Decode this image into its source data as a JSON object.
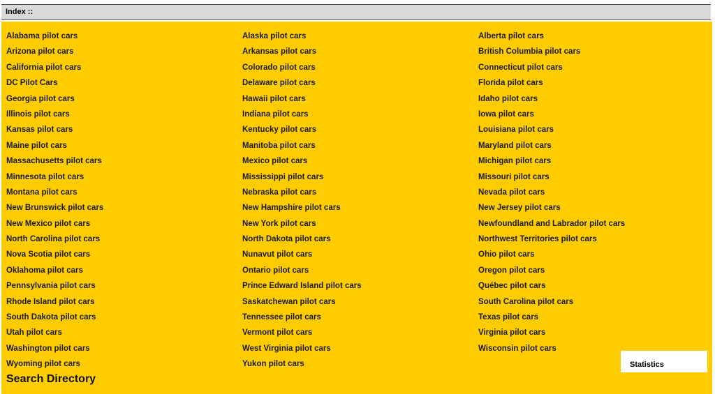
{
  "header": {
    "title": "Index ::"
  },
  "links": [
    "Alabama pilot cars",
    "Alaska pilot cars",
    "Alberta pilot cars",
    "Arizona pilot cars",
    "Arkansas pilot cars",
    "British Columbia pilot cars",
    "California pilot cars",
    "Colorado pilot cars",
    "Connecticut pilot cars",
    "DC Pilot Cars",
    "Delaware pilot cars",
    "Florida pilot cars",
    "Georgia pilot cars",
    "Hawaii pilot cars",
    "Idaho pilot cars",
    "Illinois pilot cars",
    "Indiana pilot cars",
    "Iowa pilot cars",
    "Kansas pilot cars",
    "Kentucky pilot cars",
    "Louisiana pilot cars",
    "Maine pilot cars",
    "Manitoba pilot cars",
    "Maryland pilot cars",
    "Massachusetts pilot cars",
    "Mexico pilot cars",
    "Michigan pilot cars",
    "Minnesota pilot cars",
    "Mississippi pilot cars",
    "Missouri pilot cars",
    "Montana pilot cars",
    "Nebraska pilot cars",
    "Nevada pilot cars",
    "New Brunswick pilot cars",
    "New Hampshire pilot cars",
    "New Jersey pilot cars",
    "New Mexico pilot cars",
    "New York pilot cars",
    "Newfoundland and Labrador pilot cars",
    "North Carolina pilot cars",
    "North Dakota pilot cars",
    "Northwest Territories pilot cars",
    "Nova Scotia pilot cars",
    "Nunavut pilot cars",
    "Ohio pilot cars",
    "Oklahoma pilot cars",
    "Ontario pilot cars",
    "Oregon pilot cars",
    "Pennsylvania pilot cars",
    "Prince Edward Island pilot cars",
    "Québec pilot cars",
    "Rhode Island pilot cars",
    "Saskatchewan pilot cars",
    "South Carolina pilot cars",
    "South Dakota pilot cars",
    "Tennessee pilot cars",
    "Texas pilot cars",
    "Utah pilot cars",
    "Vermont pilot cars",
    "Virginia pilot cars",
    "Washington pilot cars",
    "West Virginia pilot cars",
    "Wisconsin pilot cars",
    "Wyoming pilot cars",
    "Yukon pilot cars",
    ""
  ],
  "search": {
    "title": "Search Directory"
  },
  "stats": {
    "title": "Statistics"
  },
  "colors": {
    "panel": "#ffcc00",
    "header": "#d9d9d9"
  }
}
